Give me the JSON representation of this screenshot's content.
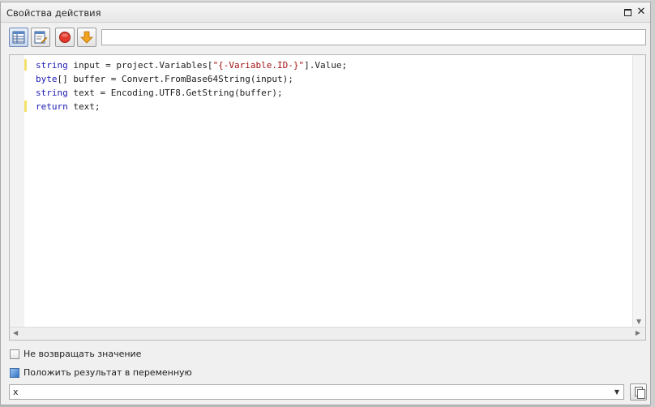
{
  "window": {
    "title": "Свойства действия"
  },
  "toolbar": {
    "buttons": [
      {
        "icon": "table-grid-icon"
      },
      {
        "icon": "edit-form-icon"
      },
      {
        "icon": "stop-red-circle-icon"
      },
      {
        "icon": "down-arrow-orange-icon"
      }
    ],
    "input_value": ""
  },
  "editor": {
    "lines": [
      {
        "keyword": "string",
        "rest_before": " input = project.Variables[",
        "string": "\"{-Variable.ID-}\"",
        "rest_after": "].Value;"
      },
      {
        "keyword": "byte",
        "rest_before": "[] buffer = Convert.FromBase64String(input);",
        "string": "",
        "rest_after": ""
      },
      {
        "keyword": "string",
        "rest_before": " text = Encoding.UTF8.GetString(buffer);",
        "string": "",
        "rest_after": ""
      },
      {
        "keyword": "return",
        "rest_before": " text;",
        "string": "",
        "rest_after": ""
      }
    ]
  },
  "options": {
    "no_return_label": "Не возвращать значение",
    "no_return_checked": false,
    "store_result_label": "Положить результат в переменную"
  },
  "variable": {
    "value": "x"
  },
  "colors": {
    "keyword": "#1a1ab5",
    "string": "#a31515",
    "change_marker": "#f5e06a"
  }
}
